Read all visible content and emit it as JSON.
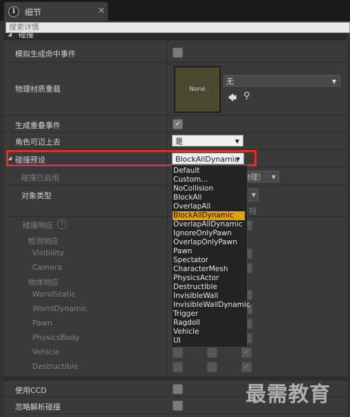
{
  "tab": {
    "icon": "i",
    "title": "细节",
    "close": "×"
  },
  "search": {
    "placeholder": "搜索详情"
  },
  "category": "碰撞",
  "rows": {
    "simulate_hit": "模拟生成命中事件",
    "phys_material": "物理材质重载",
    "gen_overlap": "生成重叠事件",
    "can_step_up": "角色可迈上去",
    "collision_preset": "碰撞预设",
    "collision_enabled": "碰撞已启用",
    "object_type": "对象类型",
    "collision_response": "碰撞响应",
    "trace_response": "检测响应",
    "visibility": "Visibility",
    "camera": "Camera",
    "object_response": "物体响应",
    "world_static": "WorldStatic",
    "world_dynamic": "WorldDynamic",
    "pawn": "Pawn",
    "physics_body": "PhysicsBody",
    "vehicle": "Vehicle",
    "destructible": "Destructible",
    "use_ccd": "使用CCD",
    "ignore_analytic": "忽略解析碰撞"
  },
  "material": {
    "thumb": "None",
    "value": "无"
  },
  "can_step_up_value": "是",
  "preset_value": "BlockAllDynamic",
  "partial_texts": {
    "enabled_partial": "物理）",
    "block_partial": "挡"
  },
  "dropdown_options": [
    "Default",
    "Custom...",
    "NoCollision",
    "BlockAll",
    "OverlapAll",
    "BlockAllDynamic",
    "OverlapAllDynamic",
    "IgnoreOnlyPawn",
    "OverlapOnlyPawn",
    "Pawn",
    "Spectator",
    "CharacterMesh",
    "PhysicsActor",
    "Destructible",
    "InvisibleWall",
    "InvisibleWallDynamic",
    "Trigger",
    "Ragdoll",
    "Vehicle",
    "UI"
  ],
  "selected_option": "BlockAllDynamic",
  "watermark": "最需教育",
  "colors": {
    "highlight": "#e03030",
    "selected": "#e0a10a"
  }
}
